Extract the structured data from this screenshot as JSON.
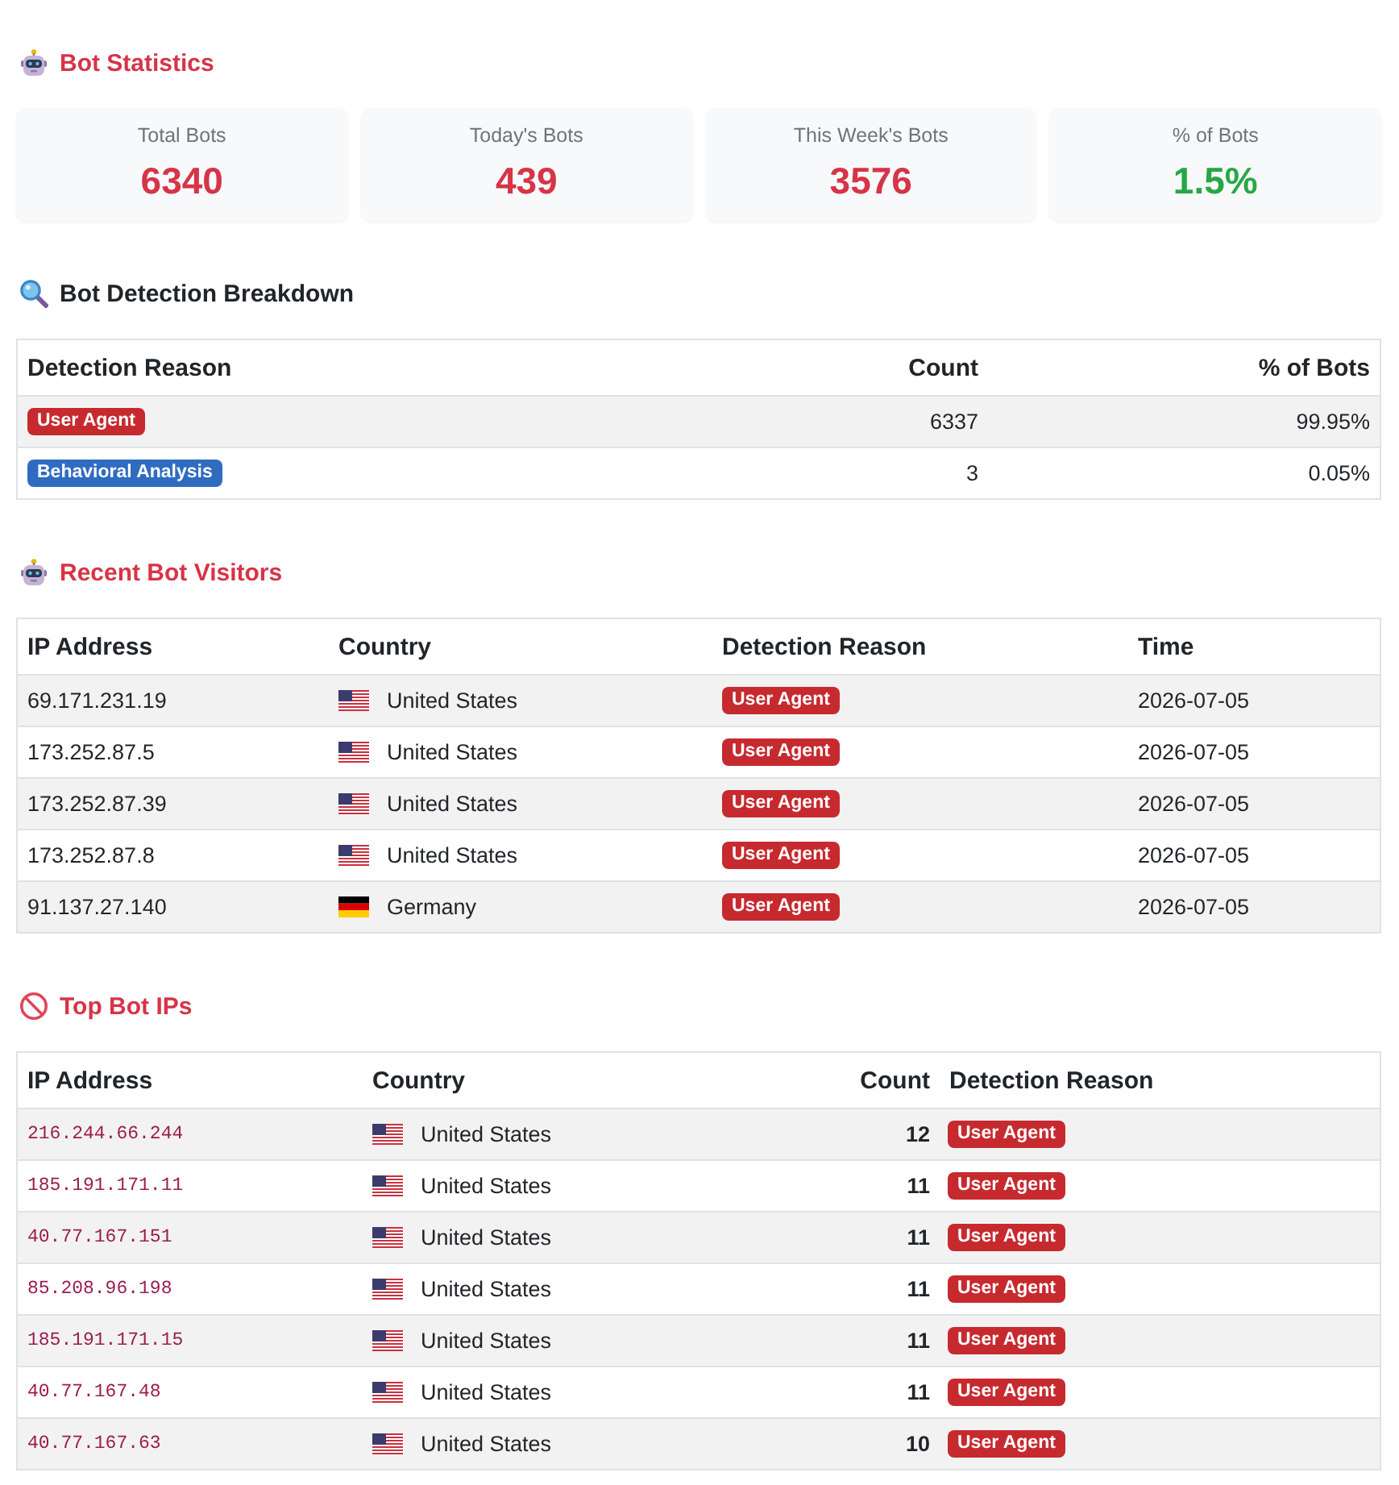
{
  "bot_statistics": {
    "title": "Bot Statistics",
    "cards": [
      {
        "label": "Total Bots",
        "value": "6340",
        "color": "#d63447"
      },
      {
        "label": "Today's Bots",
        "value": "439",
        "color": "#d63447"
      },
      {
        "label": "This Week's Bots",
        "value": "3576",
        "color": "#d63447"
      },
      {
        "label": "% of Bots",
        "value": "1.5%",
        "color": "#28a745"
      }
    ]
  },
  "detection_breakdown": {
    "title": "Bot Detection Breakdown",
    "columns": [
      "Detection Reason",
      "Count",
      "% of Bots"
    ],
    "rows": [
      {
        "reason": "User Agent",
        "color": "#c62a2f",
        "count": "6337",
        "percent": "99.95%"
      },
      {
        "reason": "Behavioral Analysis",
        "color": "#2f6cc0",
        "count": "3",
        "percent": "0.05%"
      }
    ]
  },
  "recent_bot_visitors": {
    "title": "Recent Bot Visitors",
    "columns": [
      "IP Address",
      "Country",
      "Detection Reason",
      "Time"
    ],
    "rows": [
      {
        "ip": "69.171.231.19",
        "kind": "usa",
        "country": "United States",
        "reason": "User Agent",
        "time": "2026-07-05"
      },
      {
        "ip": "173.252.87.5",
        "kind": "usa",
        "country": "United States",
        "reason": "User Agent",
        "time": "2026-07-05"
      },
      {
        "ip": "173.252.87.39",
        "kind": "usa",
        "country": "United States",
        "reason": "User Agent",
        "time": "2026-07-05"
      },
      {
        "ip": "173.252.87.8",
        "kind": "usa",
        "country": "United States",
        "reason": "User Agent",
        "time": "2026-07-05"
      },
      {
        "ip": "91.137.27.140",
        "kind": "germany",
        "country": "Germany",
        "reason": "User Agent",
        "time": "2026-07-05"
      }
    ]
  },
  "top_bot_ips": {
    "title": "Top Bot IPs",
    "columns": [
      "IP Address",
      "Country",
      "Count",
      "Detection Reason"
    ],
    "rows": [
      {
        "ip": "216.244.66.244",
        "kind": "usa",
        "country": "United States",
        "count": "12",
        "reason": "User Agent"
      },
      {
        "ip": "185.191.171.11",
        "kind": "usa",
        "country": "United States",
        "count": "11",
        "reason": "User Agent"
      },
      {
        "ip": "40.77.167.151",
        "kind": "usa",
        "country": "United States",
        "count": "11",
        "reason": "User Agent"
      },
      {
        "ip": "85.208.96.198",
        "kind": "usa",
        "country": "United States",
        "count": "11",
        "reason": "User Agent"
      },
      {
        "ip": "185.191.171.15",
        "kind": "usa",
        "country": "United States",
        "count": "11",
        "reason": "User Agent"
      },
      {
        "ip": "40.77.167.48",
        "kind": "usa",
        "country": "United States",
        "count": "11",
        "reason": "User Agent"
      },
      {
        "ip": "40.77.167.63",
        "kind": "usa",
        "country": "United States",
        "count": "10",
        "reason": "User Agent"
      }
    ]
  }
}
